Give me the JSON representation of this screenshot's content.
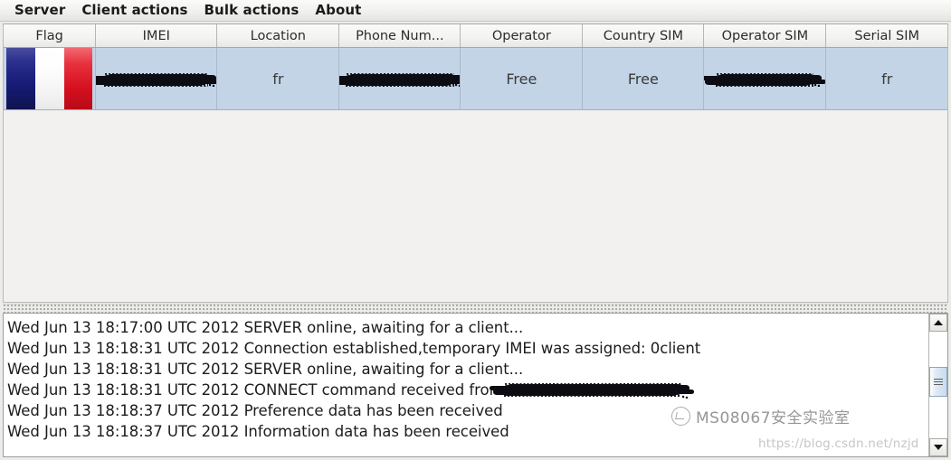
{
  "menubar": {
    "items": [
      {
        "label": "Server"
      },
      {
        "label": "Client actions"
      },
      {
        "label": "Bulk actions"
      },
      {
        "label": "About"
      }
    ]
  },
  "table": {
    "columns": [
      {
        "label": "Flag"
      },
      {
        "label": "IMEI"
      },
      {
        "label": "Location"
      },
      {
        "label": "Phone Num..."
      },
      {
        "label": "Operator"
      },
      {
        "label": "Country SIM"
      },
      {
        "label": "Operator SIM"
      },
      {
        "label": "Serial SIM"
      }
    ],
    "rows": [
      {
        "flag": "france-flag",
        "imei": "",
        "location": "fr",
        "phone_number": "",
        "operator": "Free",
        "country_sim": "Free",
        "operator_sim": "",
        "serial_sim": "fr"
      }
    ]
  },
  "log": {
    "lines": [
      {
        "text": "Wed Jun 13 18:17:00 UTC 2012 SERVER online, awaiting for a client..."
      },
      {
        "text": "Wed Jun 13 18:18:31 UTC 2012 Connection established,temporary IMEI was assigned: 0client"
      },
      {
        "text": "Wed Jun 13 18:18:31 UTC 2012 SERVER online, awaiting for a client..."
      },
      {
        "text": "Wed Jun 13 18:18:31 UTC 2012 CONNECT command received from"
      },
      {
        "text": "Wed Jun 13 18:18:37 UTC 2012 Preference data has been received"
      },
      {
        "text": "Wed Jun 13 18:18:37 UTC 2012 Information data has been received"
      }
    ]
  },
  "scrollbar": {
    "up_arrow": "triangle-up-icon",
    "down_arrow": "triangle-down-icon"
  },
  "watermark": {
    "label": "MS08067安全实验室",
    "url": "https://blog.csdn.net/nzjd"
  },
  "colors": {
    "row_selected": "#c3d4e6",
    "header_bg": "#f3f3f1",
    "flag_blue": "#161a74",
    "flag_white": "#ffffff",
    "flag_red": "#d6101f"
  }
}
